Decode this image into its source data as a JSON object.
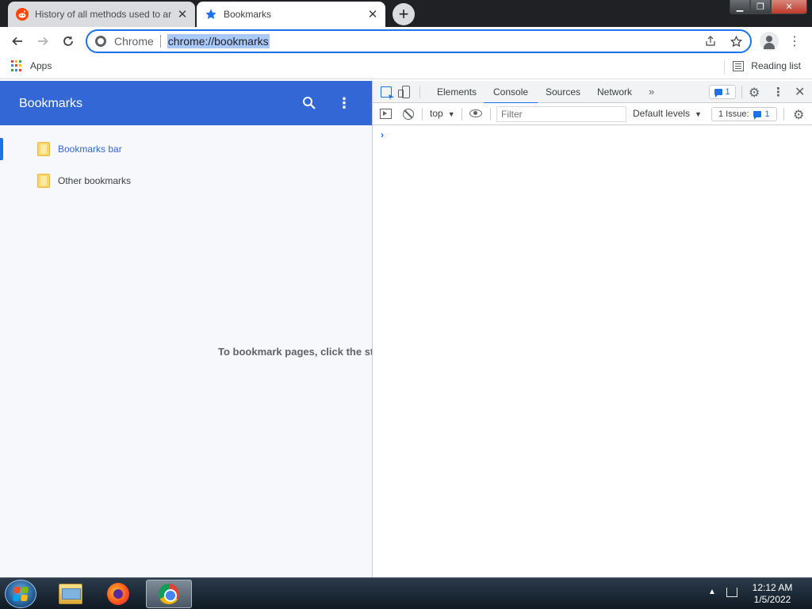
{
  "tabs": [
    {
      "title": "History of all methods used to ar",
      "favicon": "reddit-icon",
      "active": false
    },
    {
      "title": "Bookmarks",
      "favicon": "star-icon",
      "active": true
    }
  ],
  "newtab_label": "+",
  "omnibox": {
    "chip_label": "Chrome",
    "url": "chrome://bookmarks"
  },
  "bookmarks_bar": {
    "apps_label": "Apps",
    "reading_list_label": "Reading list"
  },
  "bookmarks_page": {
    "title": "Bookmarks",
    "folders": [
      {
        "label": "Bookmarks bar",
        "selected": true
      },
      {
        "label": "Other bookmarks",
        "selected": false
      }
    ],
    "empty_message": "To bookmark pages, click the st"
  },
  "devtools": {
    "tabs": [
      "Elements",
      "Console",
      "Sources",
      "Network"
    ],
    "active_tab": "Console",
    "messages_count": "1",
    "context": "top",
    "filter_placeholder": "Filter",
    "levels": "Default levels",
    "issues_label": "1 Issue:",
    "issues_count": "1",
    "prompt": "›"
  },
  "taskbar": {
    "time": "12:12 AM",
    "date": "1/5/2022"
  },
  "colors": {
    "bookmarks_header": "#3367d6",
    "accent_blue": "#1a73e8",
    "tabstrip": "#202124"
  }
}
